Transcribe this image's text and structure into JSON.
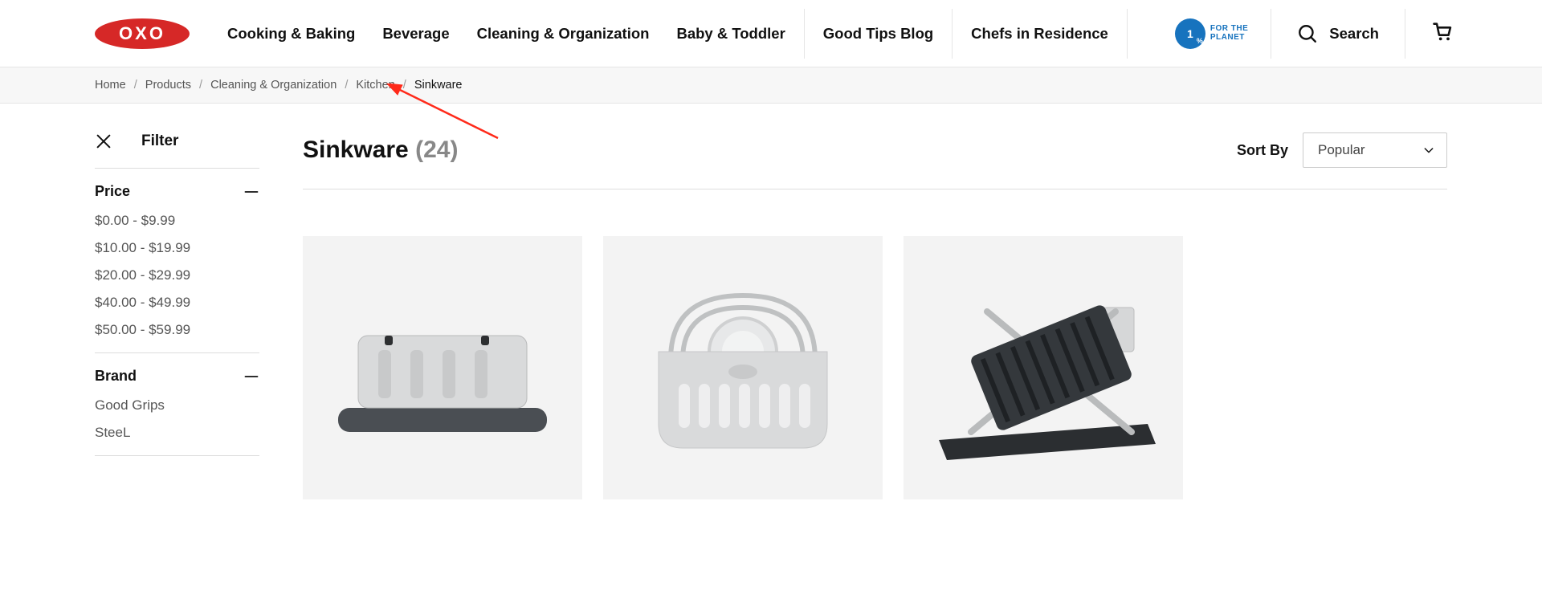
{
  "header": {
    "logo_text": "OXO",
    "nav": [
      "Cooking & Baking",
      "Beverage",
      "Cleaning & Organization",
      "Baby & Toddler",
      "Good Tips Blog",
      "Chefs in Residence"
    ],
    "planet_line1": "FOR THE",
    "planet_line2": "PLANET",
    "planet_num": "1",
    "search_label": "Search"
  },
  "breadcrumb": {
    "items": [
      "Home",
      "Products",
      "Cleaning & Organization",
      "Kitchen",
      "Sinkware"
    ]
  },
  "sidebar": {
    "filter_label": "Filter",
    "facets": [
      {
        "name": "Price",
        "options": [
          "$0.00 - $9.99",
          "$10.00 - $19.99",
          "$20.00 - $29.99",
          "$40.00 - $49.99",
          "$50.00 - $59.99"
        ]
      },
      {
        "name": "Brand",
        "options": [
          "Good Grips",
          "SteeL"
        ]
      }
    ]
  },
  "main": {
    "title": "Sinkware",
    "count": "(24)",
    "sort_label": "Sort By",
    "sort_selected": "Popular"
  }
}
